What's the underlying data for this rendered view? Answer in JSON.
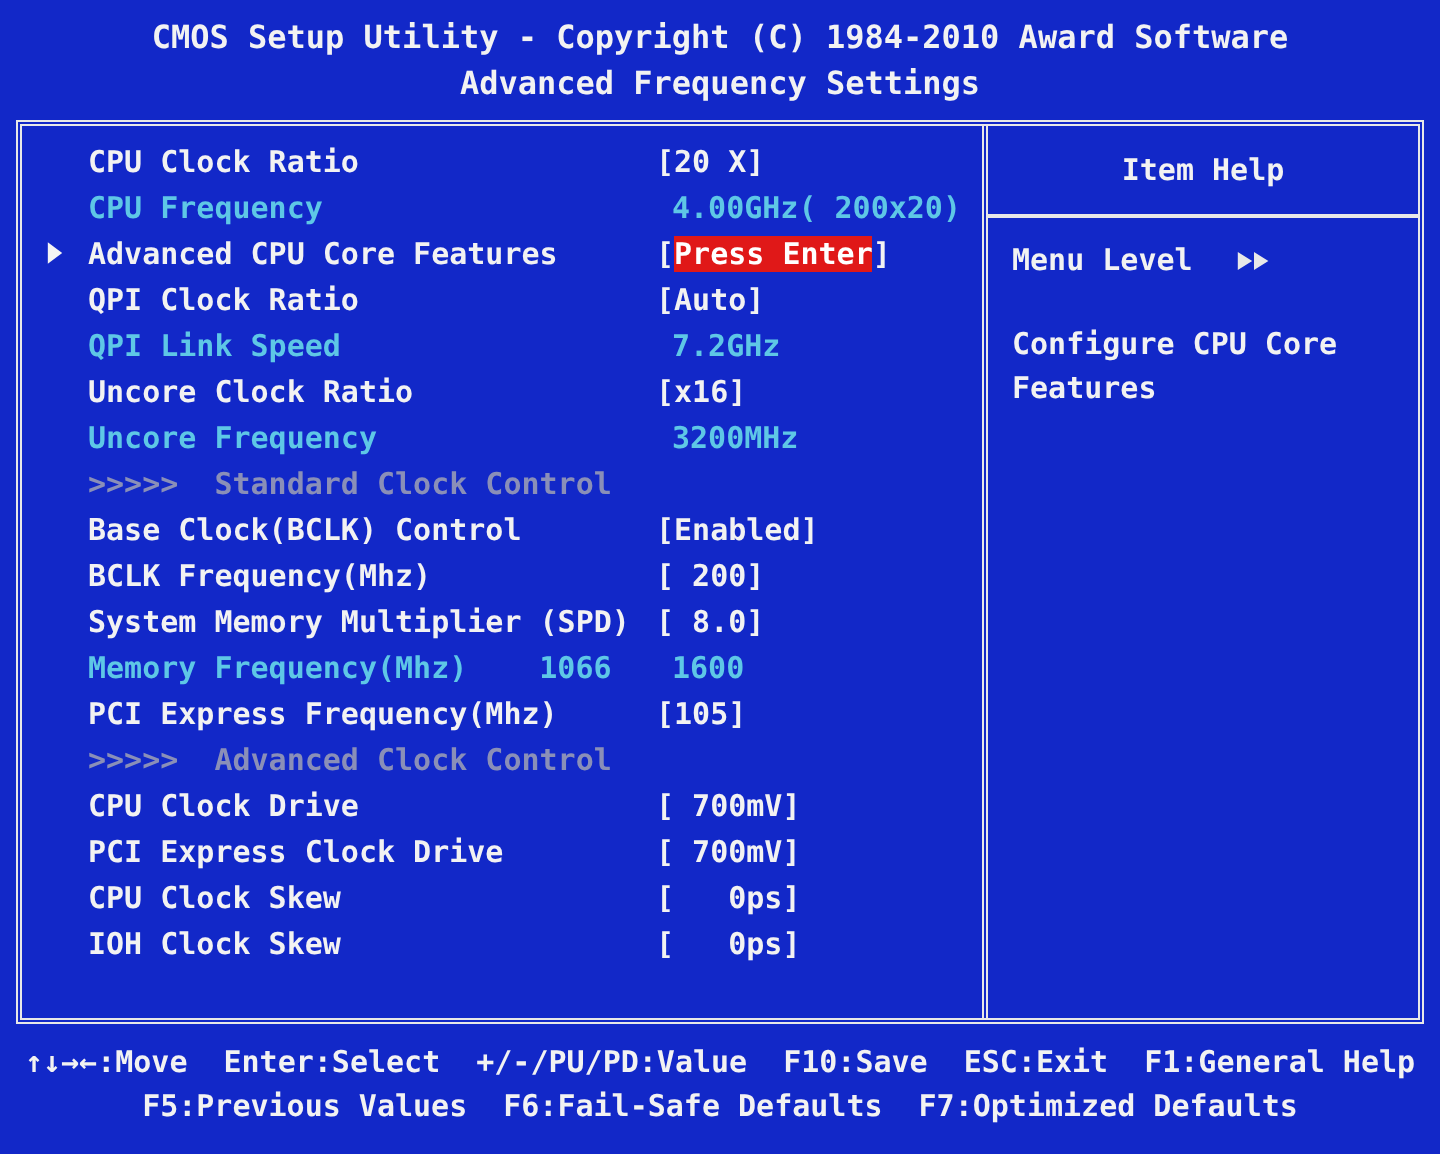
{
  "header": {
    "title": "CMOS Setup Utility - Copyright (C) 1984-2010 Award Software",
    "subtitle": "Advanced Frequency Settings"
  },
  "items": [
    {
      "kind": "setting",
      "label": "CPU Clock Ratio",
      "open": "[",
      "value": "20 X",
      "close": "]",
      "selected": false
    },
    {
      "kind": "info",
      "label": "CPU Frequency",
      "value": "4.00GHz( 200x20)",
      "selected": false
    },
    {
      "kind": "submenu",
      "label": "Advanced CPU Core Features",
      "open": "[",
      "value": "Press Enter",
      "close": "]",
      "selected": true
    },
    {
      "kind": "setting",
      "label": "QPI Clock Ratio",
      "open": "[",
      "value": "Auto",
      "close": "]",
      "selected": false
    },
    {
      "kind": "info",
      "label": "QPI Link Speed",
      "value": "7.2GHz",
      "selected": false
    },
    {
      "kind": "setting",
      "label": "Uncore Clock Ratio",
      "open": "[",
      "value": "x16",
      "close": "]",
      "selected": false
    },
    {
      "kind": "info",
      "label": "Uncore Frequency",
      "value": "3200MHz",
      "selected": false
    },
    {
      "kind": "section",
      "label": ">>>>>  Standard Clock Control"
    },
    {
      "kind": "setting",
      "label": "Base Clock(BCLK) Control",
      "open": "[",
      "value": "Enabled",
      "close": "]",
      "selected": false
    },
    {
      "kind": "setting",
      "label": "BCLK Frequency(Mhz)",
      "open": "[",
      "value": " 200",
      "close": "]",
      "selected": false
    },
    {
      "kind": "setting",
      "label": "System Memory Multiplier (SPD)",
      "open": "[",
      "value": " 8.0",
      "close": "]",
      "selected": false
    },
    {
      "kind": "info",
      "label": "Memory Frequency(Mhz)",
      "extra": "1066",
      "value": "1600",
      "selected": false
    },
    {
      "kind": "setting",
      "label": "PCI Express Frequency(Mhz)",
      "open": "[",
      "value": "105",
      "close": "]",
      "selected": false
    },
    {
      "kind": "section",
      "label": ">>>>>  Advanced Clock Control"
    },
    {
      "kind": "setting",
      "label": "CPU Clock Drive",
      "open": "[",
      "value": " 700mV",
      "close": "]",
      "selected": false
    },
    {
      "kind": "setting",
      "label": "PCI Express Clock Drive",
      "open": "[",
      "value": " 700mV",
      "close": "]",
      "selected": false
    },
    {
      "kind": "setting",
      "label": "CPU Clock Skew",
      "open": "[",
      "value": "   0ps",
      "close": "]",
      "selected": false
    },
    {
      "kind": "setting",
      "label": "IOH Clock Skew",
      "open": "[",
      "value": "   0ps",
      "close": "]",
      "selected": false
    }
  ],
  "help": {
    "title": "Item Help",
    "menu_level": "Menu Level",
    "description": "Configure CPU Core Features"
  },
  "key_lines": [
    [
      "↑↓→←:Move",
      "Enter:Select",
      "+/-/PU/PD:Value",
      "F10:Save",
      "ESC:Exit",
      "F1:General Help"
    ],
    [
      "F5:Previous Values",
      "F6:Fail-Safe Defaults",
      "F7:Optimized Defaults"
    ]
  ]
}
